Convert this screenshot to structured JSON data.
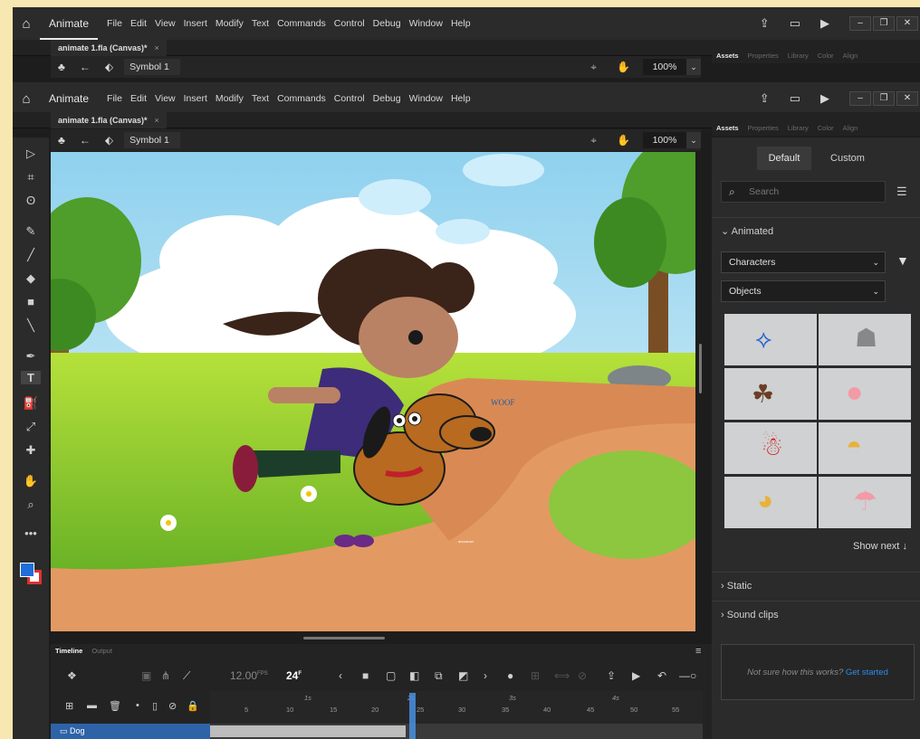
{
  "app": {
    "name": "Animate",
    "menu": [
      "File",
      "Edit",
      "View",
      "Insert",
      "Modify",
      "Text",
      "Commands",
      "Control",
      "Debug",
      "Window",
      "Help"
    ]
  },
  "document": {
    "tab": "animate 1.fla (Canvas)*",
    "close": "×",
    "symbol": "Symbol 1",
    "zoom": "100%"
  },
  "panel_tabs": [
    "Assets",
    "Properties",
    "Library",
    "Color",
    "Align"
  ],
  "assets": {
    "segments": [
      "Default",
      "Custom"
    ],
    "search_placeholder": "Search",
    "animated_label": "Animated",
    "category": "Characters",
    "subcategory": "Objects",
    "show_next": "Show next",
    "static_label": "Static",
    "sound_label": "Sound clips",
    "help_text": "Not sure how this works?",
    "get_started": "Get started"
  },
  "stage": {
    "woof": "WOOF",
    "tiny_label": "annrahan"
  },
  "timeline": {
    "tabs": [
      "Timeline",
      "Output"
    ],
    "fps": "12.00",
    "fps_unit": "FPS",
    "frame": "24",
    "frame_unit": "F",
    "seconds": [
      "1s",
      "2s",
      "3s",
      "4s"
    ],
    "frame_numbers": [
      "5",
      "10",
      "15",
      "20",
      "25",
      "30",
      "35",
      "40",
      "45",
      "50",
      "55"
    ],
    "layer": "Dog",
    "current_frame": 25
  },
  "colors": {
    "accent": "#2f63a8",
    "playhead": "#4a90e2",
    "stroke_swatch": "#1e6fd9",
    "fill_swatch": "#e03030"
  }
}
